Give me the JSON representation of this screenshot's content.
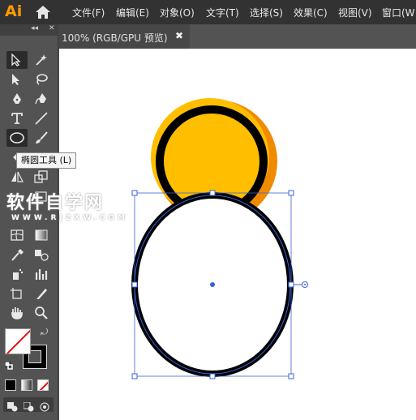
{
  "app": {
    "logo": "Ai"
  },
  "menu": [
    {
      "label": "文件(F)"
    },
    {
      "label": "编辑(E)"
    },
    {
      "label": "对象(O)"
    },
    {
      "label": "文字(T)"
    },
    {
      "label": "选择(S)"
    },
    {
      "label": "效果(C)"
    },
    {
      "label": "视图(V)"
    },
    {
      "label": "窗口(W"
    }
  ],
  "document_tab": {
    "label": "100% (RGB/GPU 预览)",
    "close": "✖"
  },
  "toolbar": {
    "collapse": "◂◂",
    "close": "✕"
  },
  "tooltip": {
    "text": "椭圆工具 (L)"
  },
  "watermark": {
    "title": "软件自学网",
    "url": "WWW.RJZXW.COM"
  },
  "colors": {
    "accent_orange": "#ff9a00",
    "fill_yellow": "#ffbe00",
    "shadow_orange": "#f08a00",
    "stroke_black": "#000000",
    "selection_blue": "#3a64d8"
  }
}
